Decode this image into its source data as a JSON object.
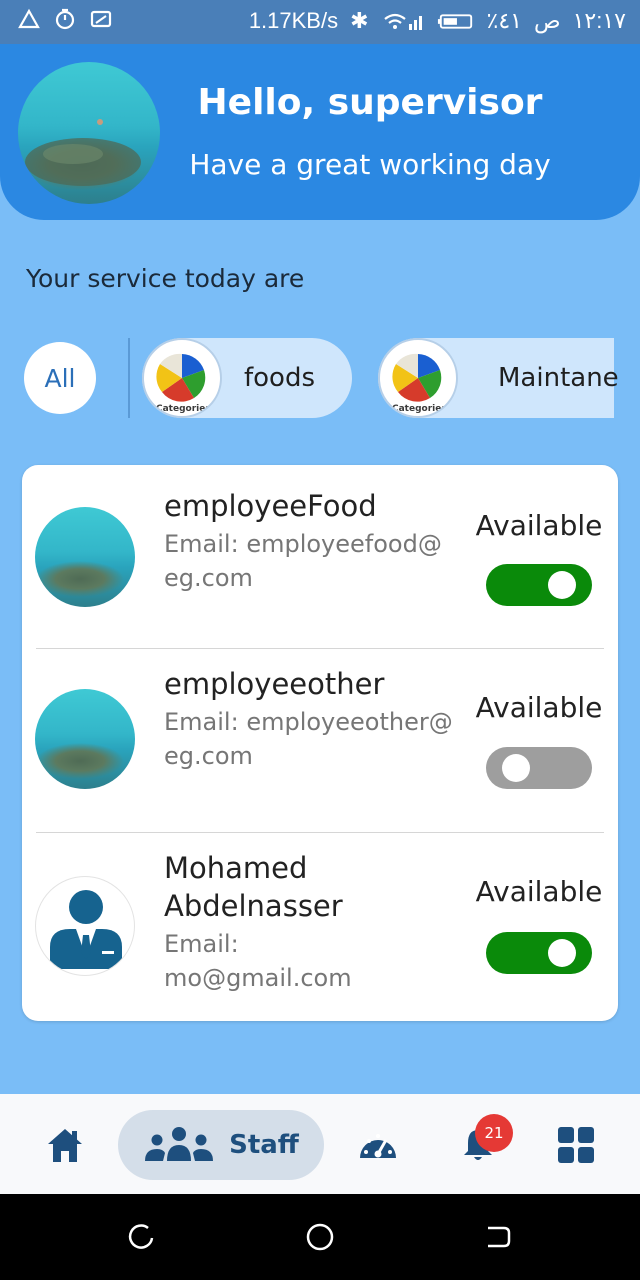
{
  "status_bar": {
    "speed": "1.17KB/s",
    "battery": "٪٤١",
    "ampm": "ص",
    "time": "١٢:١٧"
  },
  "header": {
    "title": "Hello, supervisor",
    "subtitle": "Have a great working day"
  },
  "services": {
    "title": "Your service today are",
    "all_label": "All",
    "categories": [
      {
        "label": "foods",
        "icon_caption": "Categories"
      },
      {
        "label": "Maintane",
        "icon_caption": "Categories"
      }
    ]
  },
  "staff": [
    {
      "name": "employeeFood",
      "email_label": "Email:",
      "email": "employeefood@eg.com",
      "status": "Available",
      "enabled": true
    },
    {
      "name": "employeeother",
      "email_label": "Email:",
      "email": "employeeother@eg.com",
      "status": "Available",
      "enabled": false
    },
    {
      "name": "Mohamed Abdelnasser",
      "email_label": "Email:",
      "email": "mo@gmail.com",
      "status": "Available",
      "enabled": true
    }
  ],
  "bottom_nav": {
    "items": [
      {
        "icon": "home-icon"
      },
      {
        "icon": "staff-icon",
        "label": "Staff"
      },
      {
        "icon": "dashboard-gauge-icon"
      },
      {
        "icon": "bell-icon",
        "badge": "21"
      },
      {
        "icon": "grid-icon"
      }
    ]
  },
  "colors": {
    "header": "#2B88E2",
    "background": "#7ABDF7",
    "toggle_on": "#0A8A0A",
    "toggle_off": "#9E9E9E",
    "nav_active": "#1E4F7E",
    "badge": "#E53935"
  }
}
